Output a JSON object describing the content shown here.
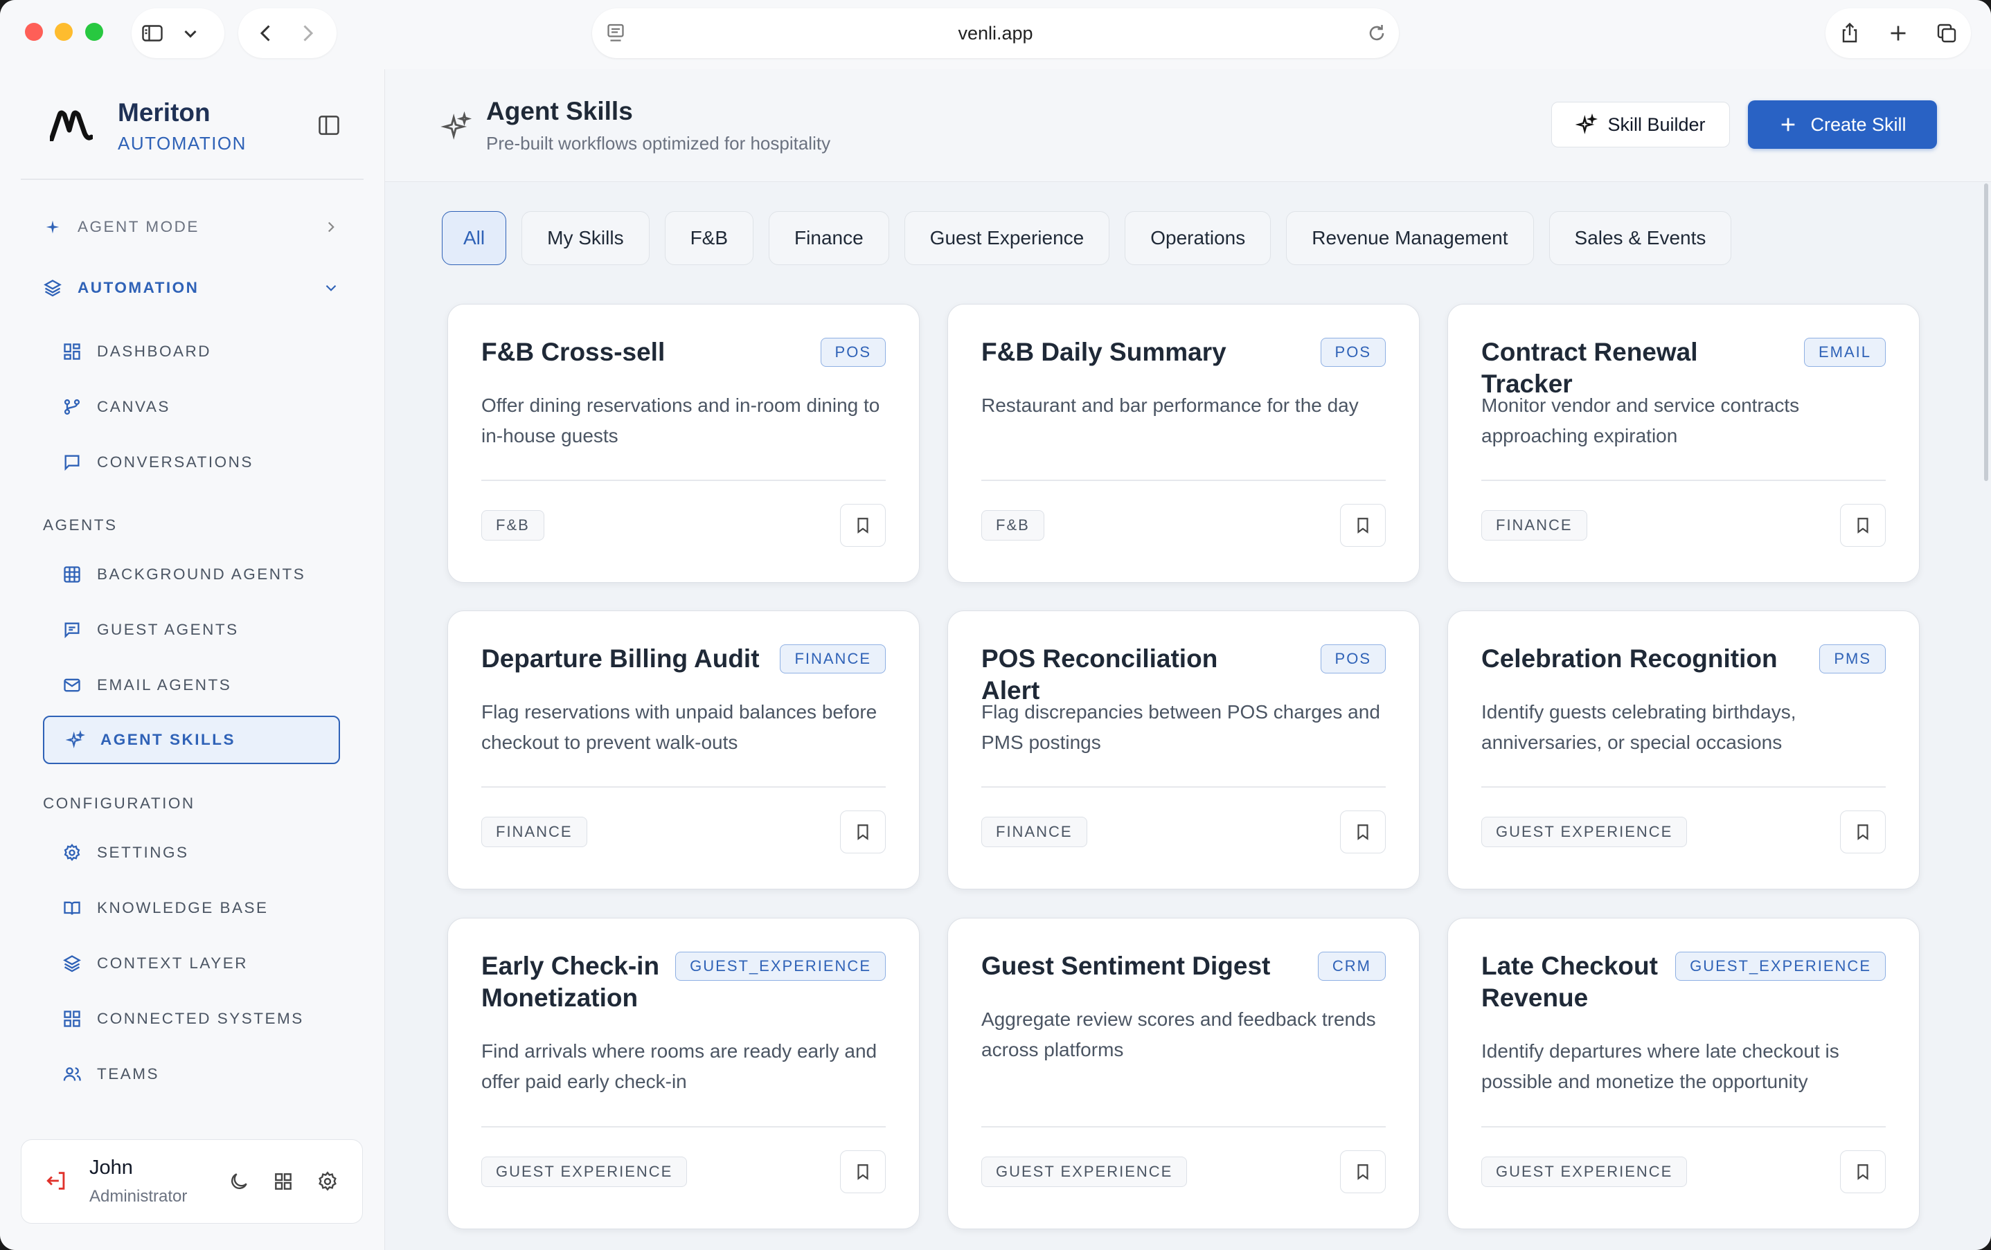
{
  "browser": {
    "url": "venli.app"
  },
  "brand": {
    "name": "Meriton",
    "subtitle": "AUTOMATION"
  },
  "sidebar": {
    "agent_mode": "AGENT MODE",
    "automation": "AUTOMATION",
    "automation_items": [
      {
        "label": "DASHBOARD",
        "icon": "dashboard-icon"
      },
      {
        "label": "CANVAS",
        "icon": "canvas-icon"
      },
      {
        "label": "CONVERSATIONS",
        "icon": "conversations-icon"
      }
    ],
    "agents_label": "AGENTS",
    "agents_items": [
      {
        "label": "BACKGROUND AGENTS",
        "icon": "background-agents-icon"
      },
      {
        "label": "GUEST AGENTS",
        "icon": "guest-agents-icon"
      },
      {
        "label": "EMAIL AGENTS",
        "icon": "email-icon"
      },
      {
        "label": "AGENT SKILLS",
        "icon": "sparkles-icon",
        "active": true
      }
    ],
    "config_label": "CONFIGURATION",
    "config_items": [
      {
        "label": "SETTINGS",
        "icon": "gear-icon"
      },
      {
        "label": "KNOWLEDGE BASE",
        "icon": "book-icon"
      },
      {
        "label": "CONTEXT LAYER",
        "icon": "layers-icon"
      },
      {
        "label": "CONNECTED SYSTEMS",
        "icon": "grid-icon"
      },
      {
        "label": "TEAMS",
        "icon": "users-icon"
      }
    ]
  },
  "user": {
    "name": "John",
    "role": "Administrator"
  },
  "header": {
    "title": "Agent Skills",
    "subtitle": "Pre-built workflows optimized for hospitality",
    "skill_builder": "Skill Builder",
    "create_skill": "Create Skill"
  },
  "filters": [
    "All",
    "My Skills",
    "F&B",
    "Finance",
    "Guest Experience",
    "Operations",
    "Revenue Management",
    "Sales & Events"
  ],
  "active_filter": "All",
  "cards": [
    {
      "title": "F&B Cross-sell",
      "badge": "POS",
      "description": "Offer dining reservations and in-room dining to in-house guests",
      "category": "F&B"
    },
    {
      "title": "F&B Daily Summary",
      "badge": "POS",
      "description": "Restaurant and bar performance for the day",
      "category": "F&B"
    },
    {
      "title": "Contract Renewal Tracker",
      "badge": "EMAIL",
      "description": "Monitor vendor and service contracts approaching expiration",
      "category": "FINANCE"
    },
    {
      "title": "Departure Billing Audit",
      "badge": "FINANCE",
      "description": "Flag reservations with unpaid balances before checkout to prevent walk-outs",
      "category": "FINANCE"
    },
    {
      "title": "POS Reconciliation Alert",
      "badge": "POS",
      "description": "Flag discrepancies between POS charges and PMS postings",
      "category": "FINANCE"
    },
    {
      "title": "Celebration Recognition",
      "badge": "PMS",
      "description": "Identify guests celebrating birthdays, anniversaries, or special occasions",
      "category": "GUEST EXPERIENCE"
    },
    {
      "title": "Early Check-in Monetization",
      "badge": "GUEST_EXPERIENCE",
      "description": "Find arrivals where rooms are ready early and offer paid early check-in",
      "category": "GUEST EXPERIENCE"
    },
    {
      "title": "Guest Sentiment Digest",
      "badge": "CRM",
      "description": "Aggregate review scores and feedback trends across platforms",
      "category": "GUEST EXPERIENCE"
    },
    {
      "title": "Late Checkout Revenue",
      "badge": "GUEST_EXPERIENCE",
      "description": "Identify departures where late checkout is possible and monetize the opportunity",
      "category": "GUEST EXPERIENCE"
    }
  ],
  "colors": {
    "accent": "#2962c4",
    "badge_bg": "#eaf1fb",
    "sidebar_active": "#2f62b7"
  }
}
